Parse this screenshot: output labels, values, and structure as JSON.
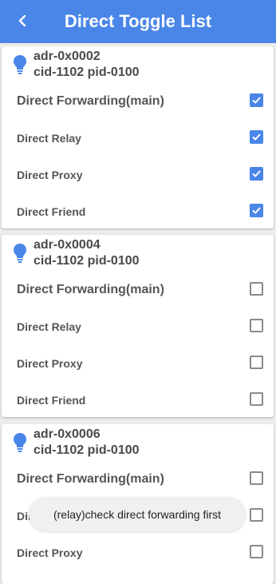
{
  "appbar": {
    "title": "Direct Toggle List",
    "back_icon": "chevron-left-icon"
  },
  "colors": {
    "accent": "#4a86e8",
    "background": "#ececec",
    "label": "#555555"
  },
  "devices": [
    {
      "address": "adr-0x0002",
      "ids": "cid-1102 pid-0100",
      "icon": "lightbulb-icon",
      "toggles": [
        {
          "label": "Direct Forwarding(main)",
          "checked": true
        },
        {
          "label": "Direct Relay",
          "checked": true
        },
        {
          "label": "Direct Proxy",
          "checked": true
        },
        {
          "label": "Direct Friend",
          "checked": true
        }
      ]
    },
    {
      "address": "adr-0x0004",
      "ids": "cid-1102 pid-0100",
      "icon": "lightbulb-icon",
      "toggles": [
        {
          "label": "Direct Forwarding(main)",
          "checked": false
        },
        {
          "label": "Direct Relay",
          "checked": false
        },
        {
          "label": "Direct Proxy",
          "checked": false
        },
        {
          "label": "Direct Friend",
          "checked": false
        }
      ]
    },
    {
      "address": "adr-0x0006",
      "ids": "cid-1102 pid-0100",
      "icon": "lightbulb-icon",
      "toggles": [
        {
          "label": "Direct Forwarding(main)",
          "checked": false
        },
        {
          "label": "Direct Relay",
          "checked": false
        },
        {
          "label": "Direct Proxy",
          "checked": false
        }
      ]
    }
  ],
  "toast": {
    "text": "(relay)check direct forwarding first"
  }
}
